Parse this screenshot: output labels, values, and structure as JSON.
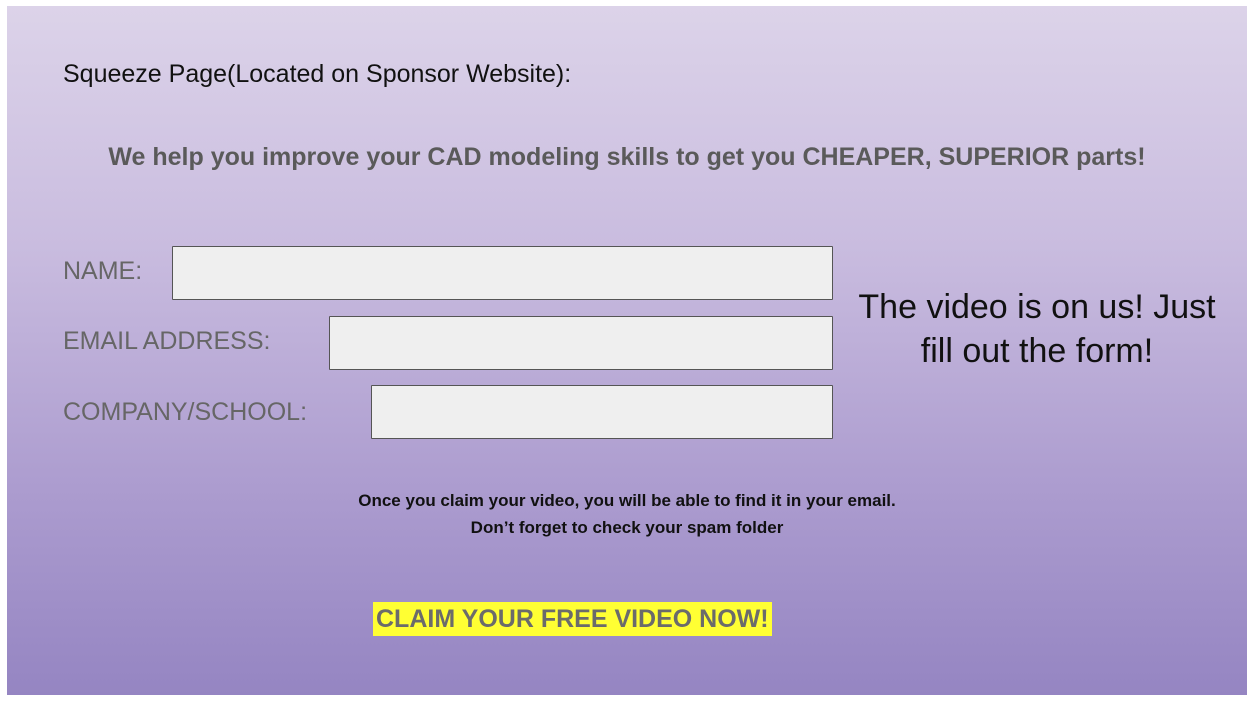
{
  "page": {
    "heading": "Squeeze Page(Located on Sponsor Website):",
    "tagline": "We help you improve your CAD modeling skills to get you CHEAPER, SUPERIOR parts!"
  },
  "form": {
    "fields": [
      {
        "label": "NAME:",
        "value": ""
      },
      {
        "label": "EMAIL ADDRESS:",
        "value": ""
      },
      {
        "label": "COMPANY/SCHOOL:",
        "value": ""
      }
    ]
  },
  "promo": {
    "text": "The video is on us! Just fill out the form!"
  },
  "notice": {
    "line1": "Once you claim your video, you will be able to find it in your email.",
    "line2": "Don’t forget to check your spam folder"
  },
  "cta": {
    "label": "CLAIM YOUR FREE VIDEO NOW!"
  },
  "colors": {
    "background_top": "#dcd3e9",
    "background_bottom": "#9585c2",
    "cta_highlight": "#ffff33",
    "label_gray": "#666666"
  }
}
